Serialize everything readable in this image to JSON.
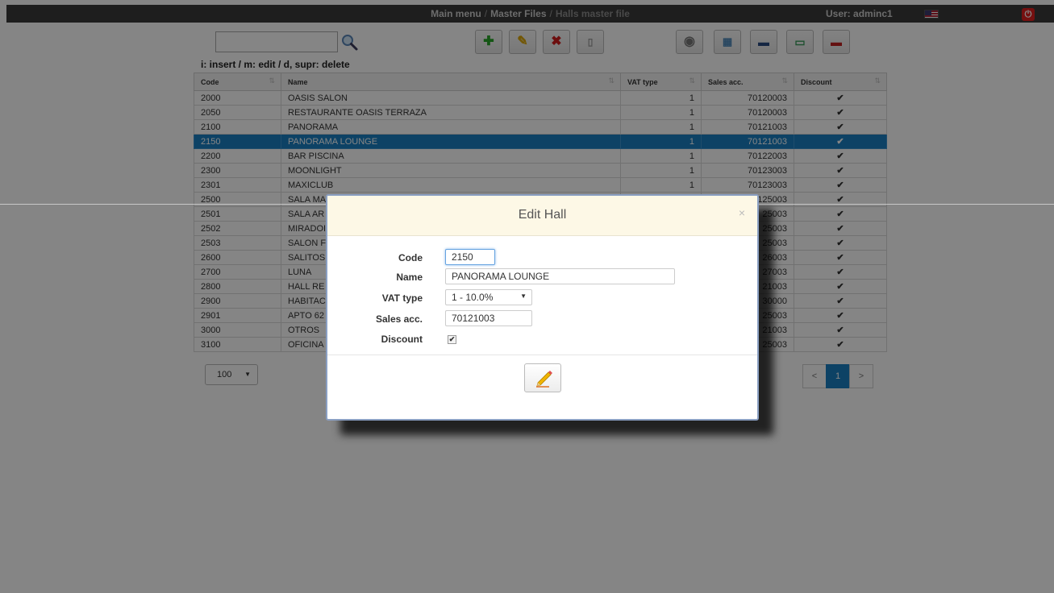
{
  "topbar": {
    "breadcrumb": [
      "Main menu",
      "Master Files",
      "Halls master file"
    ],
    "separator": "/",
    "user": "User: adminc1",
    "flag_icon": "us-flag-icon",
    "power_icon": "power-icon"
  },
  "toolbar": {
    "search_placeholder": "",
    "buttons": [
      "add-icon",
      "edit-icon",
      "delete-icon",
      "document-icon",
      "view-icon",
      "export-icon",
      "print-icon",
      "scanner-icon",
      "pdf-icon"
    ],
    "hint": "i: insert / m: edit / d, supr: delete"
  },
  "table": {
    "columns": [
      "Code",
      "Name",
      "VAT type",
      "Sales acc.",
      "Discount"
    ],
    "rows": [
      {
        "code": "2000",
        "name": "OASIS SALON",
        "vat": "1",
        "sales": "70120003",
        "discount": "✔"
      },
      {
        "code": "2050",
        "name": "RESTAURANTE OASIS TERRAZA",
        "vat": "1",
        "sales": "70120003",
        "discount": "✔"
      },
      {
        "code": "2100",
        "name": "PANORAMA",
        "vat": "1",
        "sales": "70121003",
        "discount": "✔"
      },
      {
        "code": "2150",
        "name": "PANORAMA LOUNGE",
        "vat": "1",
        "sales": "70121003",
        "discount": "✔"
      },
      {
        "code": "2200",
        "name": "BAR PISCINA",
        "vat": "1",
        "sales": "70122003",
        "discount": "✔"
      },
      {
        "code": "2300",
        "name": "MOONLIGHT",
        "vat": "1",
        "sales": "70123003",
        "discount": "✔"
      },
      {
        "code": "2301",
        "name": "MAXICLUB",
        "vat": "1",
        "sales": "70123003",
        "discount": "✔"
      },
      {
        "code": "2500",
        "name": "SALA MA",
        "vat": "",
        "sales": "125003",
        "discount": "✔"
      },
      {
        "code": "2501",
        "name": "SALA AR",
        "vat": "",
        "sales": "25003",
        "discount": "✔"
      },
      {
        "code": "2502",
        "name": "MIRADOI",
        "vat": "",
        "sales": "25003",
        "discount": "✔"
      },
      {
        "code": "2503",
        "name": "SALON F",
        "vat": "",
        "sales": "25003",
        "discount": "✔"
      },
      {
        "code": "2600",
        "name": "SALITOS",
        "vat": "",
        "sales": "26003",
        "discount": "✔"
      },
      {
        "code": "2700",
        "name": "LUNA",
        "vat": "",
        "sales": "27003",
        "discount": "✔"
      },
      {
        "code": "2800",
        "name": "HALL RE",
        "vat": "",
        "sales": "21003",
        "discount": "✔"
      },
      {
        "code": "2900",
        "name": "HABITAC",
        "vat": "",
        "sales": "30000",
        "discount": "✔"
      },
      {
        "code": "2901",
        "name": "APTO 62",
        "vat": "",
        "sales": "25003",
        "discount": "✔"
      },
      {
        "code": "3000",
        "name": "OTROS",
        "vat": "",
        "sales": "21003",
        "discount": "✔"
      },
      {
        "code": "3100",
        "name": "OFICINA",
        "vat": "",
        "sales": "25003",
        "discount": "✔"
      }
    ],
    "selected_index": 3
  },
  "pagination": {
    "page_size": "100",
    "prev": "<",
    "current": "1",
    "next": ">"
  },
  "modal": {
    "title": "Edit Hall",
    "close": "×",
    "code_label": "Code",
    "code_value": "2150",
    "name_label": "Name",
    "name_value": "PANORAMA LOUNGE",
    "vat_label": "VAT type",
    "vat_value": "1 - 10.0%",
    "sales_label": "Sales acc.",
    "sales_value": "70121003",
    "discount_label": "Discount",
    "discount_checked": true,
    "save_icon": "edit-pencil-icon"
  },
  "colors": {
    "selected_row": "#1a7fc1",
    "modal_header": "#fdf8e6",
    "topbar": "#3a3a3a"
  }
}
